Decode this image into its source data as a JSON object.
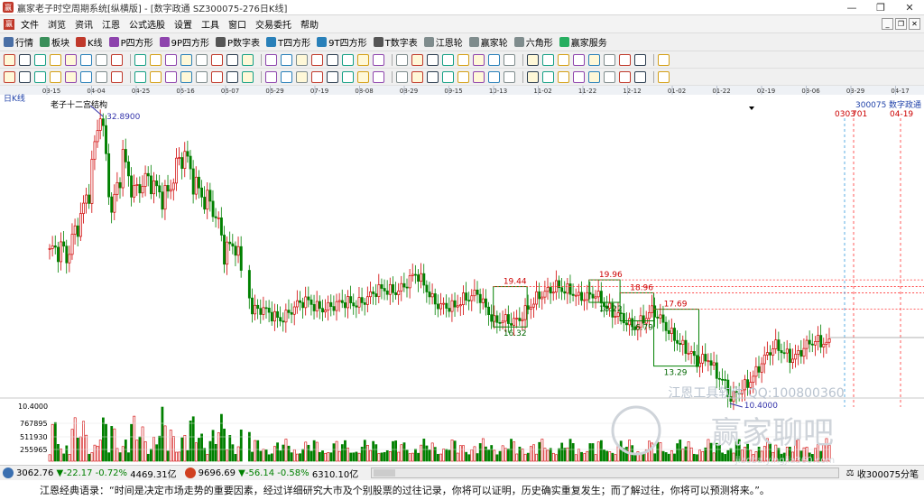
{
  "window": {
    "title": "赢家老子时空周期系统[纵横版] - [数字政通  SZ300075-276日K线]",
    "controls": [
      "—",
      "❐",
      "✕"
    ]
  },
  "menu": [
    "文件",
    "浏览",
    "资讯",
    "江恩",
    "公式选股",
    "设置",
    "工具",
    "窗口",
    "交易委托",
    "帮助"
  ],
  "toolbar1": [
    {
      "label": "行情",
      "color": "#4a6fa5"
    },
    {
      "label": "板块",
      "color": "#3a8f5a"
    },
    {
      "label": "K线",
      "color": "#c0392b"
    },
    {
      "label": "P四方形",
      "color": "#8e44ad"
    },
    {
      "label": "9P四方形",
      "color": "#8e44ad"
    },
    {
      "label": "P数字表",
      "color": "#555"
    },
    {
      "label": "T四方形",
      "color": "#2980b9"
    },
    {
      "label": "9T四方形",
      "color": "#2980b9"
    },
    {
      "label": "T数字表",
      "color": "#555"
    },
    {
      "label": "江恩轮",
      "color": "#7f8c8d"
    },
    {
      "label": "赢家轮",
      "color": "#7f8c8d"
    },
    {
      "label": "六角形",
      "color": "#7f8c8d"
    },
    {
      "label": "赢家服务",
      "color": "#27ae60"
    }
  ],
  "chart": {
    "period_label": "日K线",
    "indicator_name": "老子十二宫结构",
    "stock_code": "300075",
    "stock_name": "数字政通",
    "right_date_1": "0303",
    "right_price_1": "701",
    "right_date_2": "04-19",
    "watermark_tools": "江恩工具软件  QQ:100800360",
    "watermark_brand": "赢家聊吧",
    "watermark_sub": "jiaoba.yingjia360.com",
    "dates": [
      "03-15",
      "04-04",
      "04-25",
      "05-16",
      "06-07",
      "06-29",
      "07-19",
      "08-08",
      "08-29",
      "09-15",
      "10-13",
      "11-02",
      "11-22",
      "12-12",
      "01-02",
      "01-22",
      "02-19",
      "03-06",
      "03-29",
      "04-17"
    ],
    "annotations": {
      "high": "32.8900",
      "low": "10.4000",
      "boxes": [
        "19.44",
        "16.32",
        "19.96",
        "18.22",
        "18.96",
        "16.79",
        "17.69",
        "13.29"
      ]
    },
    "volume_axis": [
      "767895",
      "511930",
      "255965"
    ],
    "price_axis_low": "10.4000",
    "colors": {
      "up": "#d00000",
      "down": "#008000",
      "box": "#008000",
      "level": "#ff3333",
      "cursor": "#3333aa"
    }
  },
  "status": {
    "sh_index": "3062.76",
    "sh_change": "▼-22.17",
    "sh_pct": "-0.72%",
    "sh_amount": "4469.31亿",
    "sz_index": "9696.69",
    "sz_change": "▼-56.14",
    "sz_pct": "-0.58%",
    "sz_amount": "6310.10亿",
    "right_label": "收300075分笔"
  },
  "quote": "江恩经典语录：“时间是决定市场走势的重要因素，经过详细研究大市及个别股票的过往记录，你将可以证明，历史确实重复发生；而了解过往，你将可以预测将来。”。"
}
